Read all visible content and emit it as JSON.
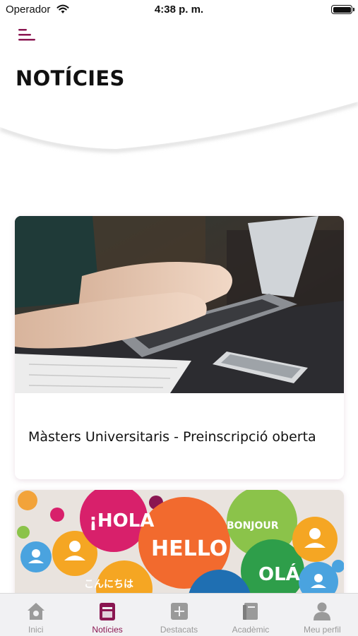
{
  "status_bar": {
    "carrier": "Operador",
    "time": "4:38 p. m."
  },
  "header": {
    "title": "NOTÍCIES",
    "menu_icon": "hamburger-menu-icon"
  },
  "news": [
    {
      "title": "Màsters Universitaris - Preinscripció oberta",
      "image": "laptop-typing-photo"
    },
    {
      "title": "",
      "image": "languages-bubbles-photo",
      "bubble_words": [
        "¡HOLA",
        "HELLO",
        "BONJOUR",
        "OLÁ",
        "こんにちは"
      ]
    }
  ],
  "tabs": [
    {
      "label": "Inici",
      "icon": "home-icon",
      "active": false
    },
    {
      "label": "Notícies",
      "icon": "news-icon",
      "active": true
    },
    {
      "label": "Destacats",
      "icon": "plus-box-icon",
      "active": false
    },
    {
      "label": "Acadèmic",
      "icon": "book-icon",
      "active": false
    },
    {
      "label": "Meu perfil",
      "icon": "user-icon",
      "active": false
    }
  ],
  "colors": {
    "accent": "#8a1651",
    "tab_inactive": "#9a9a9a",
    "tab_bar_bg": "#f1f1f3"
  }
}
